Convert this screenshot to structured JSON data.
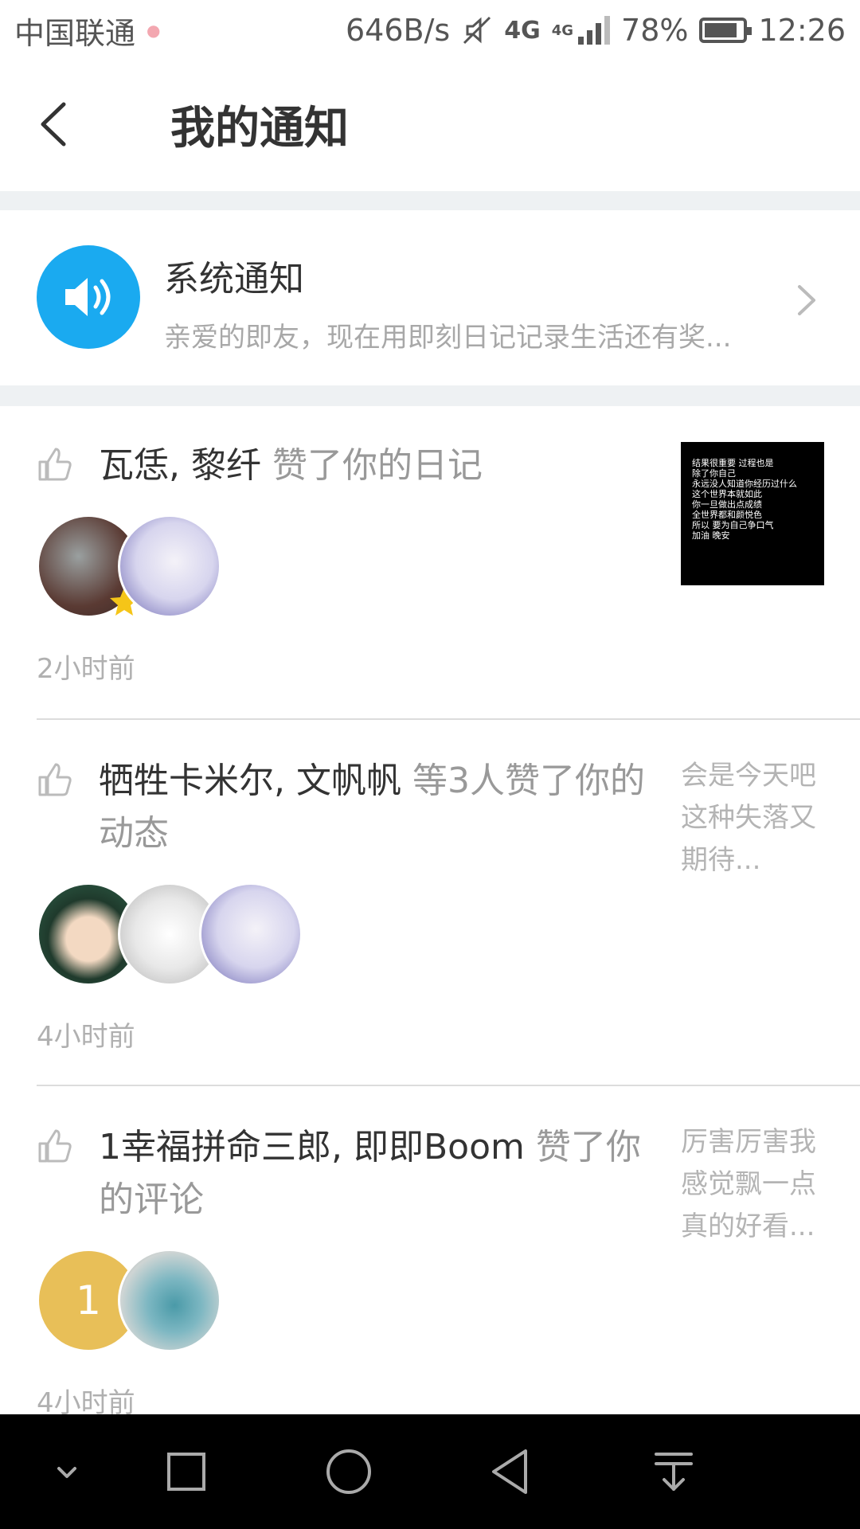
{
  "status_bar": {
    "carrier": "中国联通",
    "speed": "646B/s",
    "network": "4G",
    "network_small": "4G",
    "battery": "78%",
    "time": "12:26"
  },
  "header": {
    "title": "我的通知"
  },
  "system_notice": {
    "title": "系统通知",
    "description": "亲爱的即友，现在用即刻日记记录生活还有奖..."
  },
  "notifications": [
    {
      "users": "瓦恁, 黎纤",
      "action": " 赞了你的日记",
      "time": "2小时前",
      "preview_lines": [
        "结果很重要 过程也是",
        "除了你自己",
        "永远没人知道你经历过什么",
        "这个世界本就如此",
        "你一旦做出点成绩",
        "全世界都和颜悦色",
        "所以 要为自己争口气",
        "加油 晚安"
      ]
    },
    {
      "users": "牺牲卡米尔, 文帆帆",
      "action": " 等3人赞了你的动态",
      "time": "4小时前",
      "preview": "会是今天吧这种失落又期待..."
    },
    {
      "users": "1幸福拼命三郎, 即即Boom",
      "action": " 赞了你的评论",
      "time": "4小时前",
      "avatar_letter": "1",
      "preview": "厉害厉害我感觉飘一点真的好看..."
    }
  ],
  "colors": {
    "accent_blue": "#1aaaf0",
    "avatar_yellow": "#e8bf58"
  }
}
